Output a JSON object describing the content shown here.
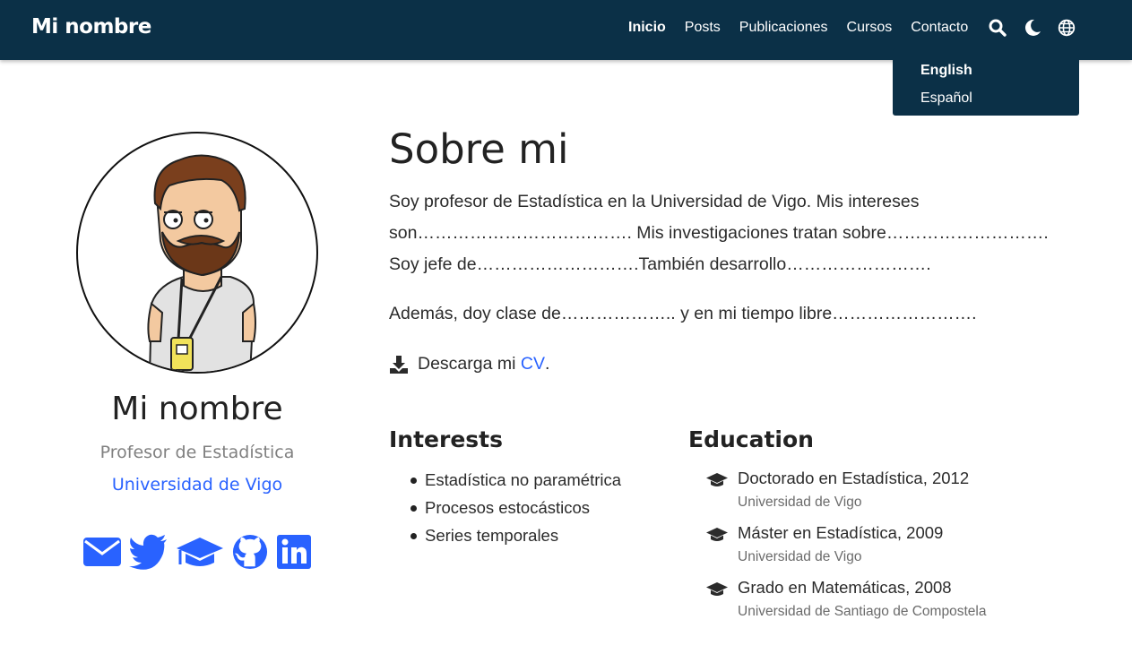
{
  "navbar": {
    "brand": "Mi nombre",
    "links": [
      {
        "label": "Inicio",
        "active": true
      },
      {
        "label": "Posts",
        "active": false
      },
      {
        "label": "Publicaciones",
        "active": false
      },
      {
        "label": "Cursos",
        "active": false
      },
      {
        "label": "Contacto",
        "active": false
      }
    ],
    "icons": [
      "search-icon",
      "moon-icon",
      "globe-icon"
    ]
  },
  "language_menu": {
    "items": [
      {
        "label": "English",
        "active": true
      },
      {
        "label": "Español",
        "active": false
      }
    ]
  },
  "profile": {
    "name": "Mi nombre",
    "role": "Profesor de Estadística",
    "organization": "Universidad de Vigo",
    "social_icons": [
      "envelope-icon",
      "twitter-icon",
      "graduation-cap-icon",
      "github-icon",
      "linkedin-icon"
    ]
  },
  "about": {
    "title": "Sobre mi",
    "paragraph1": "Soy profesor de Estadística en la Universidad de Vigo. Mis intereses son………………………………. Mis investigaciones tratan sobre………………………. Soy jefe de……………………….También desarrollo…………………….",
    "paragraph2": "Además, doy clase de……………….. y en mi tiempo libre…………………….",
    "cv_prefix": "Descarga mi ",
    "cv_link": "CV",
    "cv_suffix": "."
  },
  "interests": {
    "title": "Interests",
    "items": [
      "Estadística no paramétrica",
      "Procesos estocásticos",
      "Series temporales"
    ]
  },
  "education": {
    "title": "Education",
    "items": [
      {
        "course": "Doctorado en Estadística, 2012",
        "institution": "Universidad de Vigo"
      },
      {
        "course": "Máster en Estadística, 2009",
        "institution": "Universidad de Vigo"
      },
      {
        "course": "Grado en Matemáticas, 2008",
        "institution": "Universidad de Santiago de Compostela"
      }
    ]
  },
  "colors": {
    "navbar_bg": "#0b3047",
    "accent": "#2962ff",
    "text": "#2b2b2b",
    "muted": "#808080"
  }
}
